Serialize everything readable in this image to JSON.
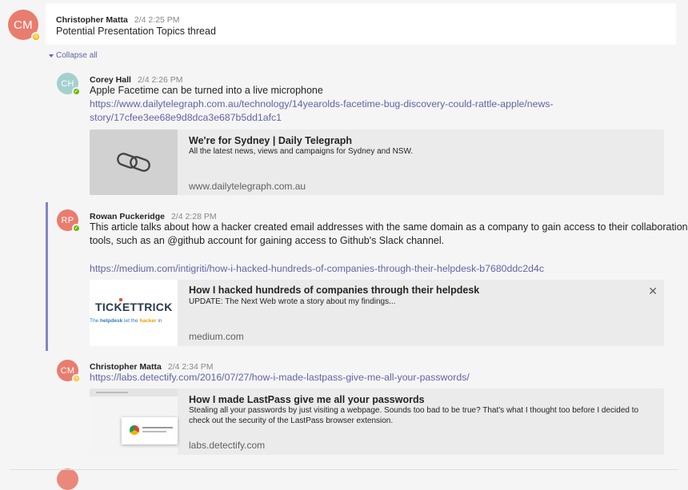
{
  "colors": {
    "accent": "#6264a7",
    "avatar_cm": "#e97c6e",
    "avatar_ch": "#a3d0cf",
    "avatar_rp": "#e97c6e",
    "away": "#f8b600",
    "available": "#6bb700"
  },
  "root": {
    "avatar_initials": "CM",
    "author": "Christopher Matta",
    "time": "2/4 2:25 PM",
    "text": "Potential Presentation Topics thread"
  },
  "collapse_label": "Collapse all",
  "replies": [
    {
      "avatar_initials": "CH",
      "author": "Corey Hall",
      "time": "2/4 2:26 PM",
      "text": "Apple Facetime can be turned into a live microphone",
      "link_line1": "https://www.dailytelegraph.com.au/technology/14yearolds-facetime-bug-discovery-could-rattle-apple/news-",
      "link_line2": "story/17cfee3ee68e9d8dca3e687b5dd1afc1",
      "preview": {
        "icon": "link-icon",
        "title": "We're for Sydney | Daily Telegraph",
        "description": "All the latest news, views and campaigns for Sydney and NSW.",
        "domain": "www.dailytelegraph.com.au"
      }
    },
    {
      "avatar_initials": "RP",
      "author": "Rowan Puckeridge",
      "time": "2/4 2:28 PM",
      "text_line1": "This article talks about how a hacker created email addresses with the same domain as a company to gain access to their collaboration",
      "text_line2": "tools, such as an @github account for gaining access to Github's Slack channel.",
      "link": "https://medium.com/intigriti/how-i-hacked-hundreds-of-companies-through-their-helpdesk-b7680ddc2d4c",
      "preview": {
        "thumb_brand": "TICKETTRICK",
        "thumb_tagline_1": "The",
        "thumb_tagline_2": "helpdesk",
        "thumb_tagline_3": "let the",
        "thumb_tagline_4": "hacker",
        "thumb_tagline_5": "in",
        "title": "How I hacked hundreds of companies through their helpdesk",
        "description": "UPDATE: The Next Web wrote a story about my findings...",
        "domain": "medium.com",
        "close_icon": "close-icon"
      }
    },
    {
      "avatar_initials": "CM",
      "author": "Christopher Matta",
      "time": "2/4 2:34 PM",
      "link": "https://labs.detectify.com/2016/07/27/how-i-made-lastpass-give-me-all-your-passwords/",
      "preview": {
        "title": "How I made LastPass give me all your passwords",
        "description": "Stealing all your passwords by just visiting a webpage. Sounds too bad to be true? That's what I thought too before I decided to check out the security of the LastPass browser extension.",
        "domain": "labs.detectify.com"
      }
    }
  ]
}
